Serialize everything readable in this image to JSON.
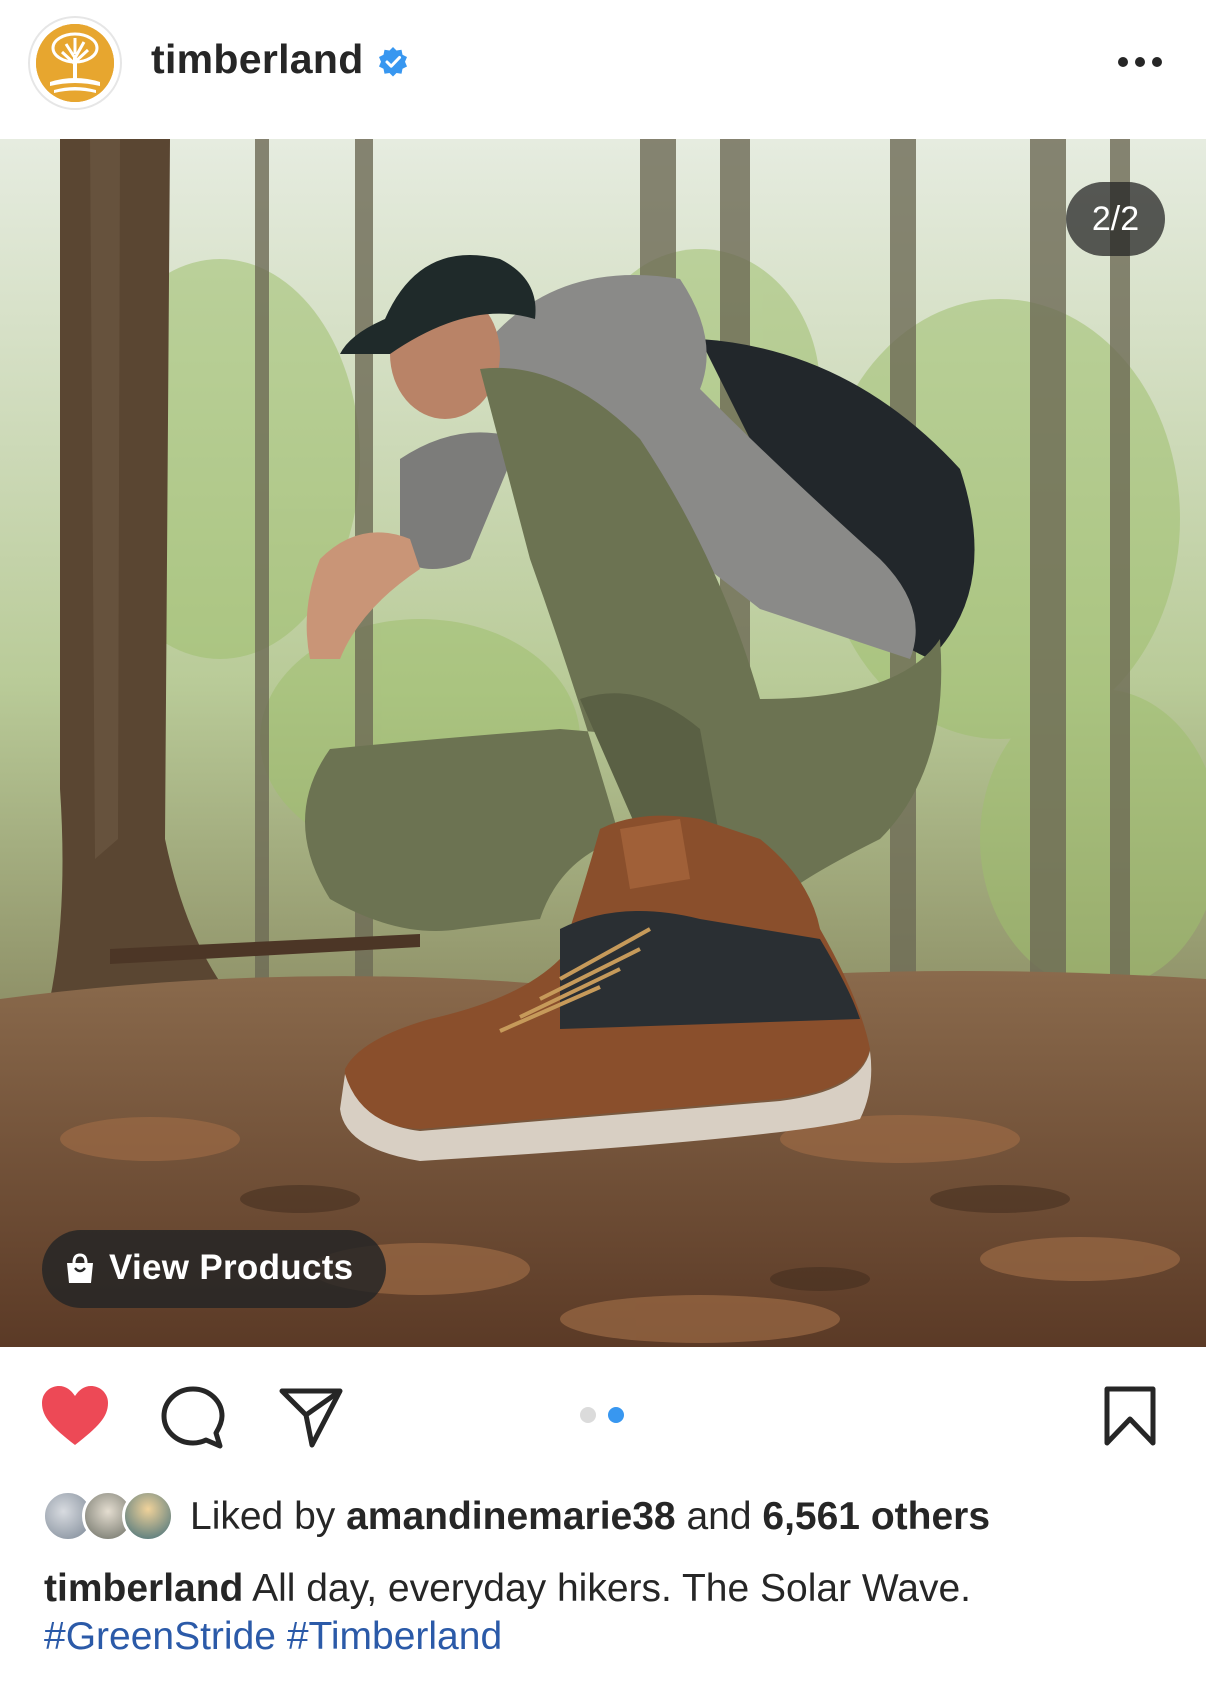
{
  "header": {
    "username": "timberland",
    "verified_icon": "verified-badge-icon",
    "more_icon": "more-options-icon"
  },
  "media": {
    "counter": "2/2",
    "view_products_label": "View Products",
    "view_products_icon": "shopping-bag-icon"
  },
  "actions": {
    "like_icon": "heart-filled-icon",
    "comment_icon": "comment-icon",
    "share_icon": "share-icon",
    "save_icon": "bookmark-icon",
    "like_color": "#ed4956",
    "carousel_total": 2,
    "carousel_active": 2,
    "dot_active_color": "#3897f0",
    "dot_inactive_color": "#dbdbdb"
  },
  "likes": {
    "prefix": "Liked by",
    "user": "amandinemarie38",
    "middle": "and",
    "others": "6,561 others"
  },
  "caption": {
    "username": "timberland",
    "text": "All day, everyday hikers. The Solar Wave.",
    "hashtags": [
      "#GreenStride",
      "#Timberland"
    ]
  }
}
